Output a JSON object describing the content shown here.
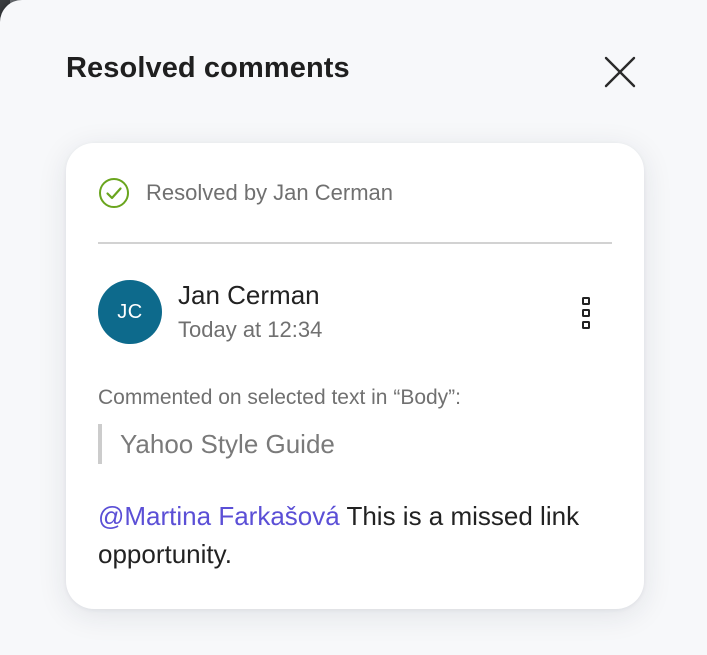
{
  "panel": {
    "title": "Resolved comments"
  },
  "comment": {
    "resolved_text": "Resolved by Jan Cerman",
    "author": {
      "initials": "JC",
      "name": "Jan Cerman",
      "time": "Today at 12:34",
      "avatar_color": "#0d6a8c"
    },
    "context_label": "Commented on selected text in “Body”:",
    "quoted_text": "Yahoo Style Guide",
    "mention": "@Martina Farkašová",
    "body_text": " This is a missed link opportunity."
  },
  "colors": {
    "resolved_check": "#6aa51e",
    "mention": "#5b4fd6"
  },
  "icons": {
    "close": "close-icon",
    "resolved": "check-circle-icon",
    "more": "more-vertical-icon"
  }
}
